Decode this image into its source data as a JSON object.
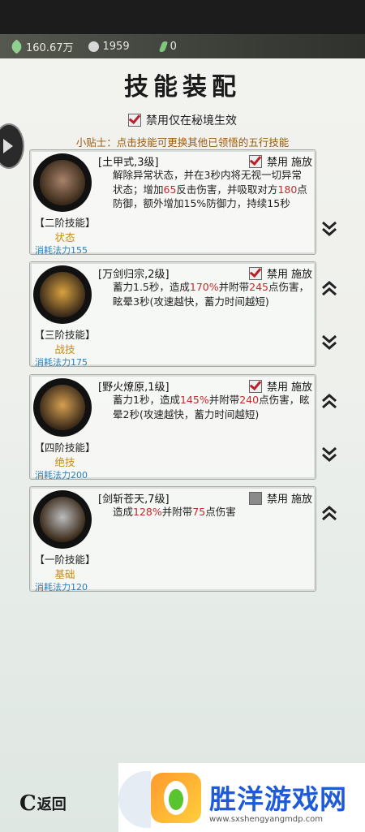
{
  "resources": [
    {
      "icon": "jade-icon",
      "value": "160.67万",
      "color": "#8fd08f"
    },
    {
      "icon": "silver-icon",
      "value": "1959",
      "color": "#d8d8d8"
    },
    {
      "icon": "feather-icon",
      "value": "0",
      "color": "#7cc87c"
    }
  ],
  "title": "技能装配",
  "banner_option": {
    "label": "禁用仅在秘境生效",
    "checked": true
  },
  "tip": "小贴士：点击技能可更换其他已领悟的五行技能",
  "control_labels": {
    "disable": "禁用",
    "cast": "施放"
  },
  "skills": [
    {
      "name": "[土甲式,3级]",
      "tier": "【二阶技能】",
      "category": "状态",
      "cost": "消耗法力155",
      "disabled": true,
      "desc_parts": [
        "解除异常状态，并在3秒内将无视一切异常状态；增加",
        "65",
        "反击伤害，并吸取对方",
        "180",
        "点防御，额外增加15%防御力，持续15秒"
      ],
      "icon": "earth-armor-icon",
      "icon_color": "#a8826a",
      "arrows": [
        "down"
      ]
    },
    {
      "name": "[万剑归宗,2级]",
      "tier": "【三阶技能】",
      "category": "战技",
      "cost": "消耗法力175",
      "disabled": true,
      "desc_parts": [
        "蓄力1.5秒，造成",
        "170%",
        "并附带",
        "245",
        "点伤害，眩晕3秒(攻速越快，蓄力时间越短)"
      ],
      "icon": "sword-rain-icon",
      "icon_color": "#d8a240",
      "arrows": [
        "up",
        "down"
      ]
    },
    {
      "name": "[野火燎原,1级]",
      "tier": "【四阶技能】",
      "category": "绝技",
      "cost": "消耗法力200",
      "disabled": true,
      "desc_parts": [
        "蓄力1秒，造成",
        "145%",
        "并附带",
        "240",
        "点伤害，眩晕2秒(攻速越快，蓄力时间越短)"
      ],
      "icon": "wildfire-icon",
      "icon_color": "#d6a050",
      "arrows": [
        "up",
        "down"
      ]
    },
    {
      "name": "[剑斩苍天,7级]",
      "tier": "【一阶技能】",
      "category": "基础",
      "cost": "消耗法力120",
      "disabled": false,
      "desc_parts": [
        "造成",
        "128%",
        "并附带",
        "75",
        "点伤害"
      ],
      "icon": "sword-slash-icon",
      "icon_color": "#bcbcbc",
      "arrows": [
        "up"
      ]
    }
  ],
  "back_label": "返回",
  "watermark": {
    "text": "胜洋游戏网",
    "url": "www.sxshengyangmdp.com"
  }
}
